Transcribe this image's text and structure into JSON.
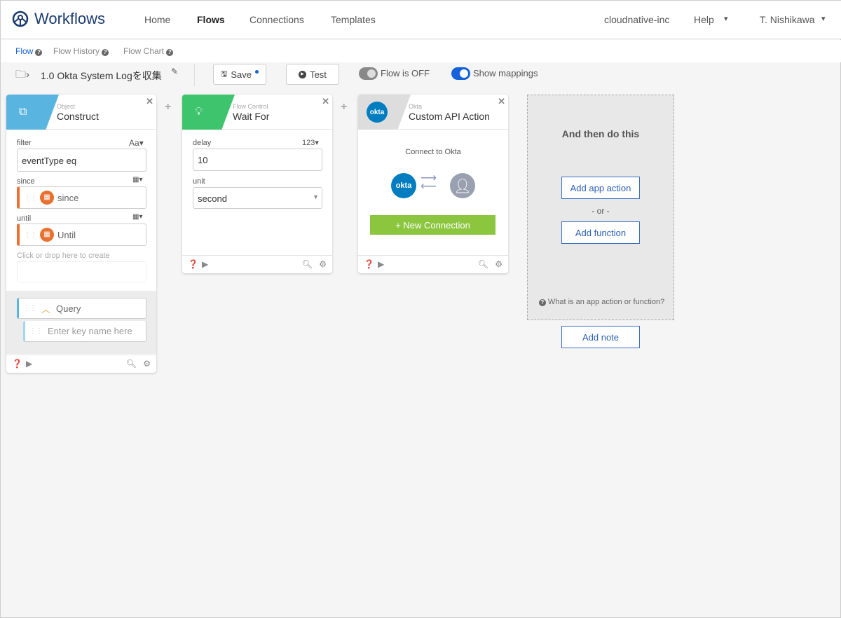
{
  "app": {
    "title": "Workflows"
  },
  "nav": {
    "items": [
      "Home",
      "Flows",
      "Connections",
      "Templates"
    ],
    "org": "cloudnative-inc",
    "help": "Help",
    "user": "T. Nishikawa"
  },
  "subnav": {
    "flow": "Flow",
    "history": "Flow History",
    "chart": "Flow Chart"
  },
  "toolbar": {
    "flow_name": "1.0 Okta System Logを収集",
    "save": "Save",
    "test": "Test",
    "flow_status": "Flow is OFF",
    "show_mappings": "Show mappings"
  },
  "cards": [
    {
      "category": "Object",
      "title": "Construct",
      "filter_label": "filter",
      "filter_type": "Aa",
      "filter_value": "eventType eq",
      "since_label": "since",
      "since_value": "since",
      "until_label": "until",
      "until_value": "Until",
      "create_hint": "Click or drop here to create",
      "query": "Query",
      "key_placeholder": "Enter key name here"
    },
    {
      "category": "Flow Control",
      "title": "Wait For",
      "delay_label": "delay",
      "delay_type": "123",
      "delay_value": "10",
      "unit_label": "unit",
      "unit_value": "second"
    },
    {
      "category": "Okta",
      "title": "Custom API Action",
      "connect_text": "Connect to Okta",
      "okta_logo": "okta",
      "new_connection": "+ New Connection"
    }
  ],
  "next": {
    "title": "And then do this",
    "add_app_action": "Add app action",
    "or": "- or -",
    "add_function": "Add function",
    "help": "What is an app action or function?",
    "add_note": "Add note"
  },
  "colors": {
    "accent": "#1662dd",
    "construct": "#5ab4e0",
    "waitfor": "#3ec46d",
    "okta": "#007dc1",
    "new_connection": "#8cc63f"
  }
}
